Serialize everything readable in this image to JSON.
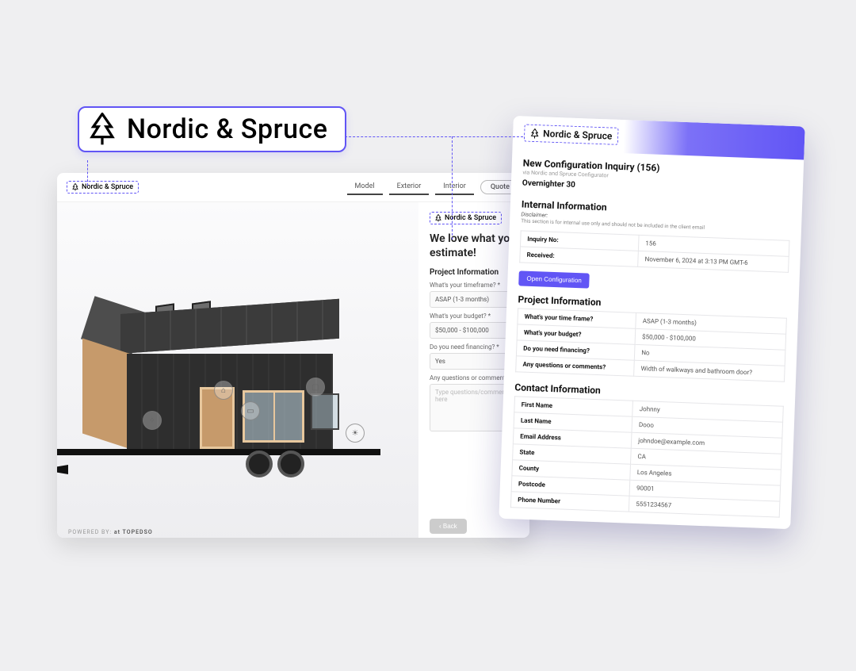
{
  "brand": {
    "name": "Nordic & Spruce"
  },
  "configurator": {
    "brand_small": "Nordic & Spruce",
    "tabs": {
      "model": "Model",
      "exterior": "Exterior",
      "interior": "Interior",
      "quote": "Quote"
    },
    "powered_label": "POWERED BY:",
    "powered_name": "at TOPEDSO",
    "form_brand": "Nordic & Spruce",
    "form_title_line1": "We love what you",
    "form_title_line2": "estimate!",
    "form_section": "Project Information",
    "timeframe_label": "What's your timeframe? *",
    "timeframe_value": "ASAP (1-3 months)",
    "budget_label": "What's your budget? *",
    "budget_value": "$50,000 - $100,000",
    "financing_label": "Do you need financing? *",
    "financing_value": "Yes",
    "comments_label": "Any questions or comments?",
    "comments_placeholder": "Type questions/comments here",
    "back_label": "‹  Back"
  },
  "inquiry": {
    "brand_chip": "Nordic & Spruce",
    "title": "New Configuration Inquiry (156)",
    "via": "via Nordic and Spruce Configurator",
    "model": "Overnighter 30",
    "internal_title": "Internal Information",
    "disclaimer_lbl": "Disclaimer:",
    "disclaimer_txt": "This section is for internal use only and should not be included in the client email",
    "internal_rows": {
      "inquiry_no_key": "Inquiry No:",
      "inquiry_no_val": "156",
      "received_key": "Received:",
      "received_val": "November 6, 2024 at 3:13 PM GMT-6"
    },
    "open_btn": "Open Configuration",
    "project_title": "Project Information",
    "project_rows": {
      "timeframe_key": "What's your time frame?",
      "timeframe_val": "ASAP (1-3 months)",
      "budget_key": "What's your budget?",
      "budget_val": "$50,000 - $100,000",
      "financing_key": "Do you need financing?",
      "financing_val": "No",
      "comments_key": "Any questions or comments?",
      "comments_val": "Width of walkways and bathroom door?"
    },
    "contact_title": "Contact Information",
    "contact_rows": {
      "first_key": "First Name",
      "first_val": "Johnny",
      "last_key": "Last Name",
      "last_val": "Dooo",
      "email_key": "Email Address",
      "email_val": "johndoe@example.com",
      "state_key": "State",
      "state_val": "CA",
      "county_key": "County",
      "county_val": "Los Angeles",
      "postcode_key": "Postcode",
      "postcode_val": "90001",
      "phone_key": "Phone Number",
      "phone_val": "5551234567"
    }
  }
}
